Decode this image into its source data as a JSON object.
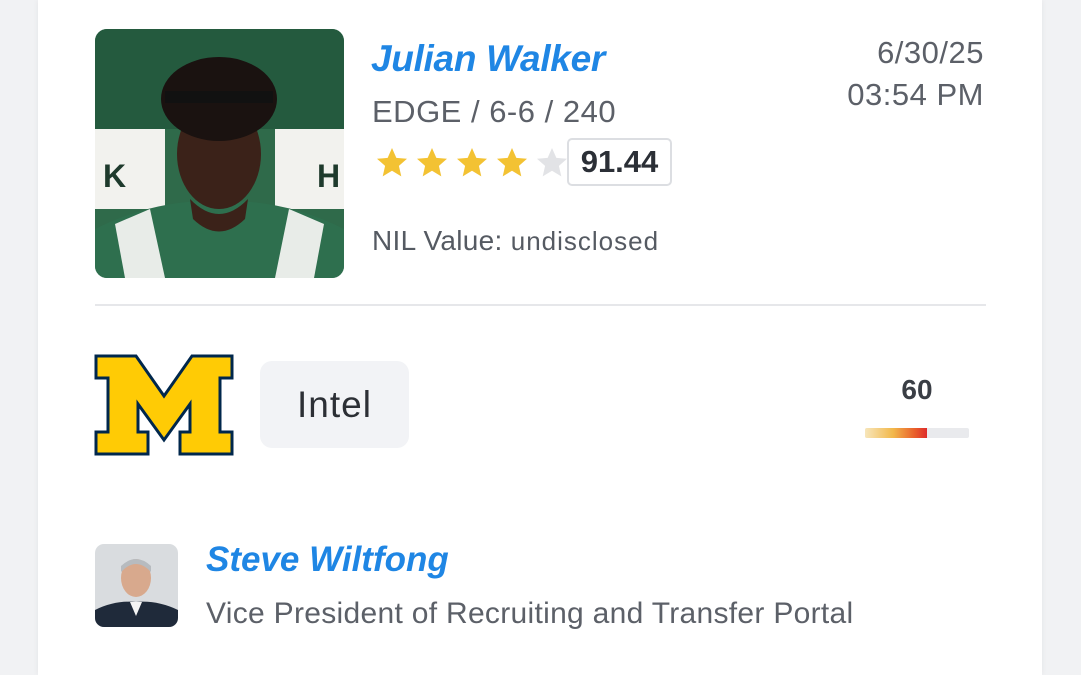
{
  "player": {
    "name": "Julian Walker",
    "meta": "EDGE / 6-6 / 240",
    "stars_filled": 4,
    "stars_total": 5,
    "rating": "91.44",
    "nil_label": "NIL Value:",
    "nil_value": "undisclosed"
  },
  "timestamp": {
    "date": "6/30/25",
    "time": "03:54 PM"
  },
  "school": {
    "logo_letter": "M",
    "logo_color": "#FFCB05",
    "logo_outline": "#00274C"
  },
  "intel": {
    "label": "Intel"
  },
  "meter": {
    "value": "60",
    "fill_fraction": 0.6
  },
  "author": {
    "name": "Steve Wiltfong",
    "title": "Vice President of Recruiting and Transfer Portal"
  },
  "colors": {
    "accent": "#1f86e4",
    "star_on": "#f3c233",
    "star_off": "#e2e3e6"
  }
}
